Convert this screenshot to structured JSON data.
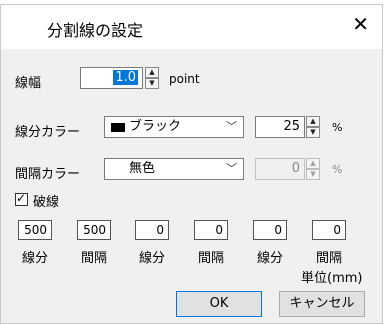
{
  "dialog": {
    "title": "分割線の設定",
    "close_glyph": "✕"
  },
  "width_row": {
    "label": "線幅",
    "value": "1.0",
    "unit": "point"
  },
  "color_row": {
    "label": "線分カラー",
    "color_name": "ブラック",
    "percent": "25",
    "percent_unit": "%",
    "swatch_color": "#000000"
  },
  "gap_color_row": {
    "label": "間隔カラー",
    "color_name": "無色",
    "percent": "0",
    "percent_unit": "%"
  },
  "dashed": {
    "label": "破線",
    "checked": true
  },
  "pattern": {
    "values": [
      "500",
      "500",
      "0",
      "0",
      "0",
      "0"
    ],
    "labels": [
      "線分",
      "間隔",
      "線分",
      "間隔",
      "線分",
      "間隔"
    ],
    "unit_label": "単位(mm)"
  },
  "buttons": {
    "ok": "OK",
    "cancel": "キャンセル"
  },
  "colors": {
    "accent": "#0078d7",
    "selection": "#0078d7"
  }
}
